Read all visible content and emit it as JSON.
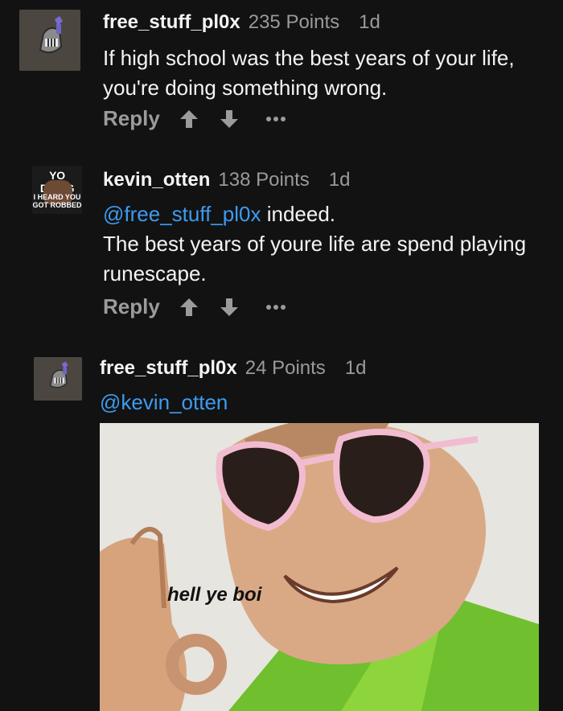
{
  "comments": [
    {
      "username": "free_stuff_pl0x",
      "points": "235 Points",
      "age": "1d",
      "text": "If high school was the best years of your life, you're doing something wrong.",
      "reply_label": "Reply",
      "avatar_icon": "helmet-avatar"
    },
    {
      "username": "kevin_otten",
      "points": "138 Points",
      "age": "1d",
      "mention": "@free_stuff_pl0x",
      "text_after_mention": " indeed.",
      "text_line2": "The best years of youre life are spend playing runescape.",
      "reply_label": "Reply",
      "avatar_top_text": "YO DAWG",
      "avatar_bottom_text": "I HEARD YOU GOT ROBBED"
    },
    {
      "username": "free_stuff_pl0x",
      "points": "24 Points",
      "age": "1d",
      "mention": "@kevin_otten",
      "image_caption": "hell ye boi",
      "avatar_icon": "helmet-avatar"
    }
  ],
  "colors": {
    "background": "#121212",
    "mention": "#3d9bf0",
    "muted": "#9a9a9a"
  },
  "icons": [
    "upvote-icon",
    "downvote-icon",
    "more-icon"
  ]
}
